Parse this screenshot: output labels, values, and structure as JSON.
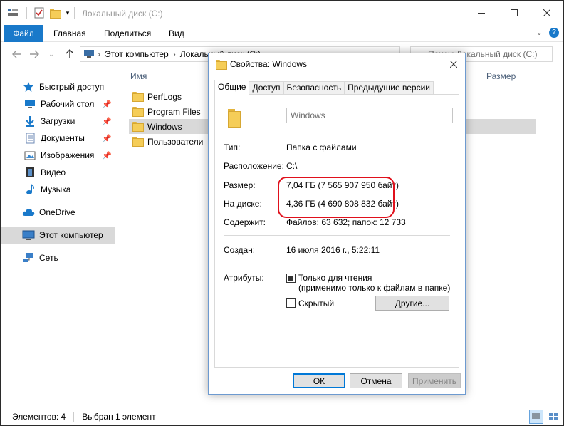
{
  "window": {
    "title": "Локальный диск (C:)",
    "minimize_icon": "minimize-icon",
    "maximize_icon": "maximize-icon",
    "close_icon": "close-icon"
  },
  "ribbon": {
    "tabs": [
      {
        "label": "Файл",
        "active": true
      },
      {
        "label": "Главная"
      },
      {
        "label": "Поделиться"
      },
      {
        "label": "Вид"
      }
    ]
  },
  "address": {
    "path": [
      "Этот компьютер",
      "Локальный диск (C:)"
    ],
    "search_placeholder": "Поиск: Локальный диск (C:)"
  },
  "sidebar": {
    "items": [
      {
        "label": "Быстрый доступ",
        "icon": "star-icon",
        "pinned": false
      },
      {
        "label": "Рабочий стол",
        "icon": "desktop-icon",
        "pinned": true
      },
      {
        "label": "Загрузки",
        "icon": "download-icon",
        "pinned": true
      },
      {
        "label": "Документы",
        "icon": "documents-icon",
        "pinned": true
      },
      {
        "label": "Изображения",
        "icon": "pictures-icon",
        "pinned": true
      },
      {
        "label": "Видео",
        "icon": "video-icon",
        "pinned": false
      },
      {
        "label": "Музыка",
        "icon": "music-icon",
        "pinned": false
      },
      {
        "label": "OneDrive",
        "icon": "cloud-icon",
        "pinned": false
      },
      {
        "label": "Этот компьютер",
        "icon": "computer-icon",
        "pinned": false,
        "selected": true
      },
      {
        "label": "Сеть",
        "icon": "network-icon",
        "pinned": false
      }
    ]
  },
  "files": {
    "columns": {
      "name": "Имя",
      "size": "Размер"
    },
    "rows": [
      {
        "name": "PerfLogs"
      },
      {
        "name": "Program Files"
      },
      {
        "name": "Windows",
        "selected": true
      },
      {
        "name": "Пользователи"
      }
    ]
  },
  "status": {
    "count": "Элементов: 4",
    "selected": "Выбран 1 элемент"
  },
  "dialog": {
    "title": "Свойства: Windows",
    "tabs": [
      "Общие",
      "Доступ",
      "Безопасность",
      "Предыдущие версии"
    ],
    "name_value": "Windows",
    "fields": {
      "type_label": "Тип:",
      "type_value": "Папка с файлами",
      "location_label": "Расположение:",
      "location_value": "C:\\",
      "size_label": "Размер:",
      "size_value": "7,04 ГБ (7 565 907 950 байт)",
      "disk_label": "На диске:",
      "disk_value": "4,36 ГБ (4 690 808 832 байт)",
      "contains_label": "Содержит:",
      "contains_value": "Файлов: 63 632; папок: 12 733",
      "created_label": "Создан:",
      "created_value": "16 июля 2016 г., 5:22:11",
      "attributes_label": "Атрибуты:",
      "readonly_label": "Только для чтения",
      "readonly_sub": "(применимо только к файлам в папке)",
      "readonly_state": "indeterminate",
      "hidden_label": "Скрытый",
      "hidden_checked": false,
      "other_button": "Другие..."
    },
    "buttons": {
      "ok": "ОК",
      "cancel": "Отмена",
      "apply": "Применить"
    },
    "highlight_color": "#e0101b"
  }
}
